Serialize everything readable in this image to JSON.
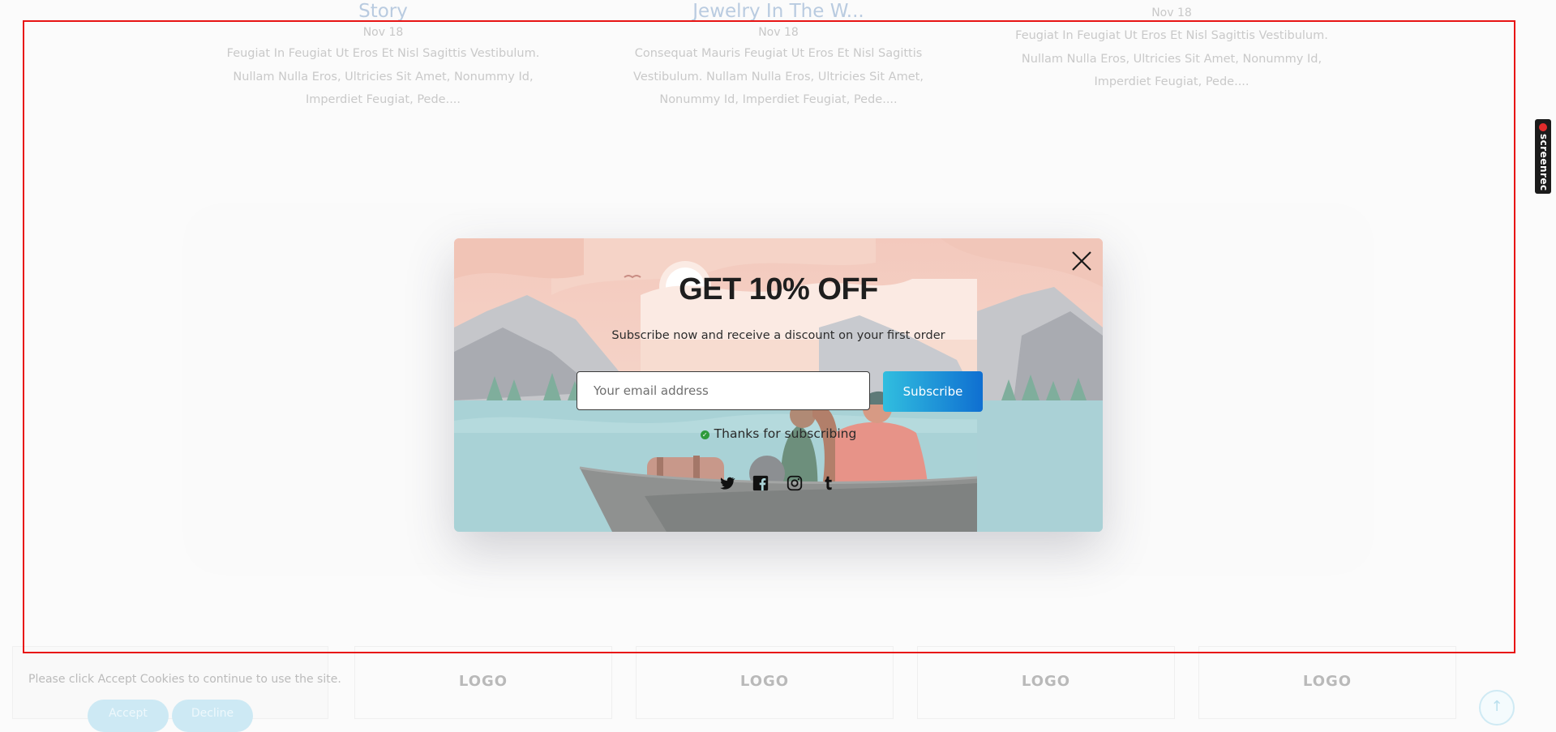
{
  "blog_posts": [
    {
      "title": "Story",
      "date": "Nov 18",
      "excerpt": [
        "Feugiat In Feugiat Ut Eros Et Nisl Sagittis Vestibulum.",
        "Nullam Nulla Eros, Ultricies Sit Amet, Nonummy Id,",
        "Imperdiet Feugiat, Pede...."
      ]
    },
    {
      "title": "Jewelry In The W...",
      "date": "Nov 18",
      "excerpt": [
        "Consequat Mauris Feugiat Ut Eros Et Nisl Sagittis",
        "Vestibulum. Nullam Nulla Eros, Ultricies Sit Amet,",
        "Nonummy Id, Imperdiet Feugiat, Pede...."
      ]
    },
    {
      "date": "Nov 18",
      "excerpt": [
        "Feugiat In Feugiat Ut Eros Et Nisl Sagittis Vestibulum.",
        "Nullam Nulla Eros, Ultricies Sit Amet, Nonummy Id,",
        "Imperdiet Feugiat, Pede...."
      ]
    }
  ],
  "popup": {
    "title": "GET 10% OFF",
    "subtitle": "Subscribe now and receive a discount on your first order",
    "email_placeholder": "Your email address",
    "subscribe_label": "Subscribe",
    "thanks_message": "Thanks for subscribing",
    "close_icon": "close-icon",
    "social_icons": [
      "twitter-icon",
      "facebook-icon",
      "instagram-icon",
      "tumblr-icon"
    ],
    "accent_gradient": [
      "#31bedf",
      "#0f6fd1"
    ]
  },
  "cookie_notice": {
    "text": "Please click Accept Cookies to continue to use the site.",
    "accept_label": "Accept",
    "decline_label": "Decline"
  },
  "brand_logos": [
    "LOGO",
    "LOGO",
    "LOGO",
    "LOGO"
  ],
  "screen_recorder": {
    "label": "screenrec"
  },
  "colors": {
    "selection_frame": "#e81414",
    "page_background": "#fbfbfb"
  }
}
